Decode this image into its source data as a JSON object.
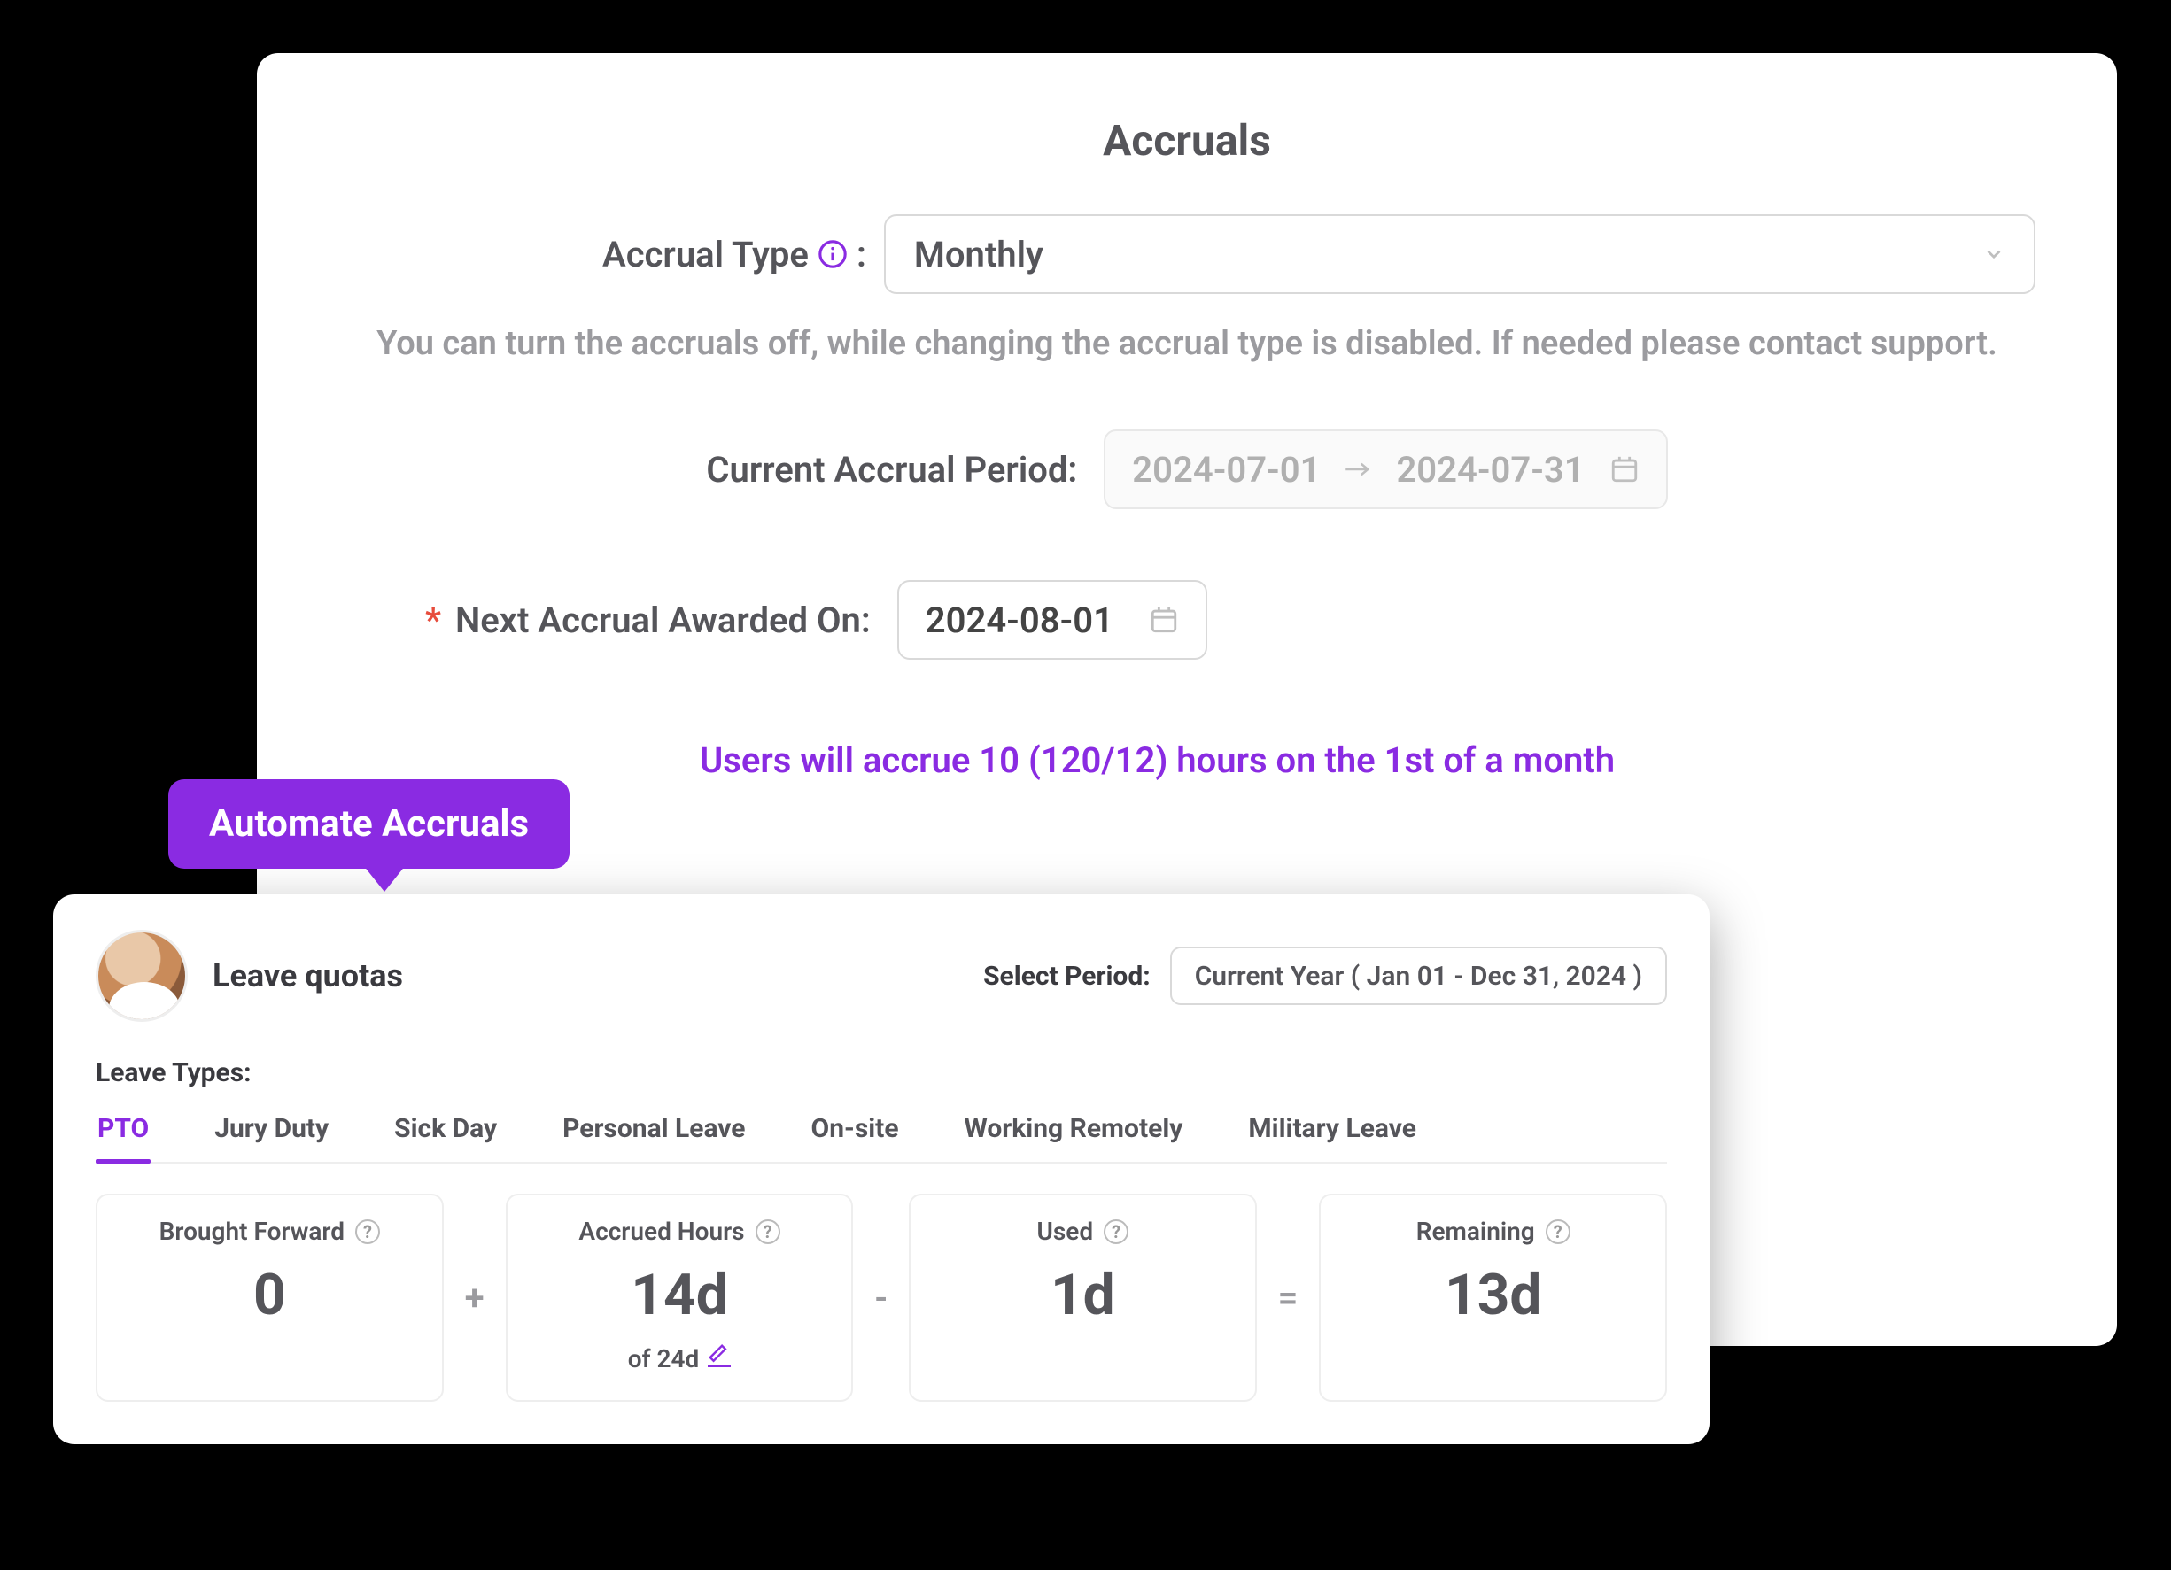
{
  "accruals": {
    "title": "Accruals",
    "type_label": "Accrual Type",
    "type_value": "Monthly",
    "help_text": "You can turn the accruals off, while changing the accrual type is disabled. If needed please contact support.",
    "current_period_label": "Current Accrual Period:",
    "current_period_start": "2024-07-01",
    "current_period_end": "2024-07-31",
    "next_award_label": "Next Accrual Awarded On:",
    "next_award_date": "2024-08-01",
    "note": "Users will accrue 10 (120/12) hours on the 1st of a month"
  },
  "tooltip": {
    "label": "Automate Accruals"
  },
  "quotas": {
    "title": "Leave quotas",
    "period_label": "Select Period:",
    "period_value": "Current Year ( Jan 01 - Dec 31, 2024 )",
    "types_label": "Leave Types:",
    "tabs": [
      "PTO",
      "Jury Duty",
      "Sick Day",
      "Personal Leave",
      "On-site",
      "Working Remotely",
      "Military Leave"
    ],
    "active_tab": 0,
    "stats": {
      "brought_forward": {
        "label": "Brought Forward",
        "value": "0"
      },
      "accrued": {
        "label": "Accrued Hours",
        "value": "14d",
        "sub": "of 24d"
      },
      "used": {
        "label": "Used",
        "value": "1d"
      },
      "remaining": {
        "label": "Remaining",
        "value": "13d"
      }
    },
    "ops": {
      "plus": "+",
      "minus": "-",
      "equals": "="
    }
  }
}
